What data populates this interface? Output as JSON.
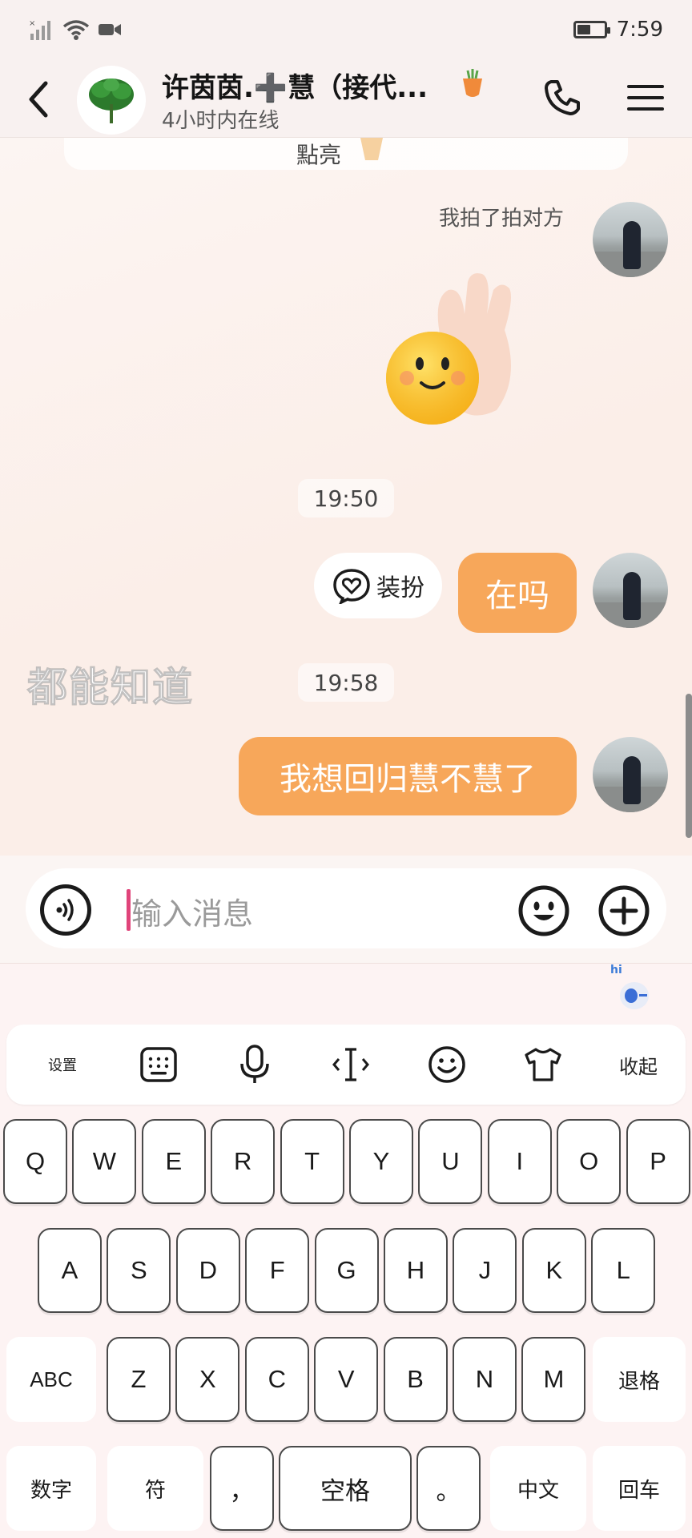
{
  "status_bar": {
    "time": "7:59",
    "battery_level": 0.5
  },
  "header": {
    "contact_name": "许茵茵.➕慧（接代...",
    "contact_status": "4小时内在线"
  },
  "chat": {
    "previous_card_text": "點亮",
    "pat_notice": "我拍了拍对方",
    "messages": [
      {
        "time": "19:50",
        "text": "在吗",
        "dress_up_label": "装扮"
      },
      {
        "time": "19:58",
        "text": "我想回归慧不慧了"
      }
    ],
    "watermark": "都能知道"
  },
  "input": {
    "placeholder": "输入消息"
  },
  "keyboard": {
    "mascot_text": "hi",
    "toolbar": {
      "settings_label": "设置",
      "collapse_label": "收起"
    },
    "row1": [
      "Q",
      "W",
      "E",
      "R",
      "T",
      "Y",
      "U",
      "I",
      "O",
      "P"
    ],
    "row2": [
      "A",
      "S",
      "D",
      "F",
      "G",
      "H",
      "J",
      "K",
      "L"
    ],
    "row3_letters": [
      "Z",
      "X",
      "C",
      "V",
      "B",
      "N",
      "M"
    ],
    "abc_label": "ABC",
    "backspace_label": "退格",
    "numbers_label": "数字",
    "symbols_label": "符",
    "comma_label": "，",
    "space_label": "空格",
    "period_label": "。",
    "chinese_label": "中文",
    "enter_label": "回车"
  },
  "colors": {
    "accent_bubble": "#f7a75a",
    "cursor": "#e0447a"
  }
}
